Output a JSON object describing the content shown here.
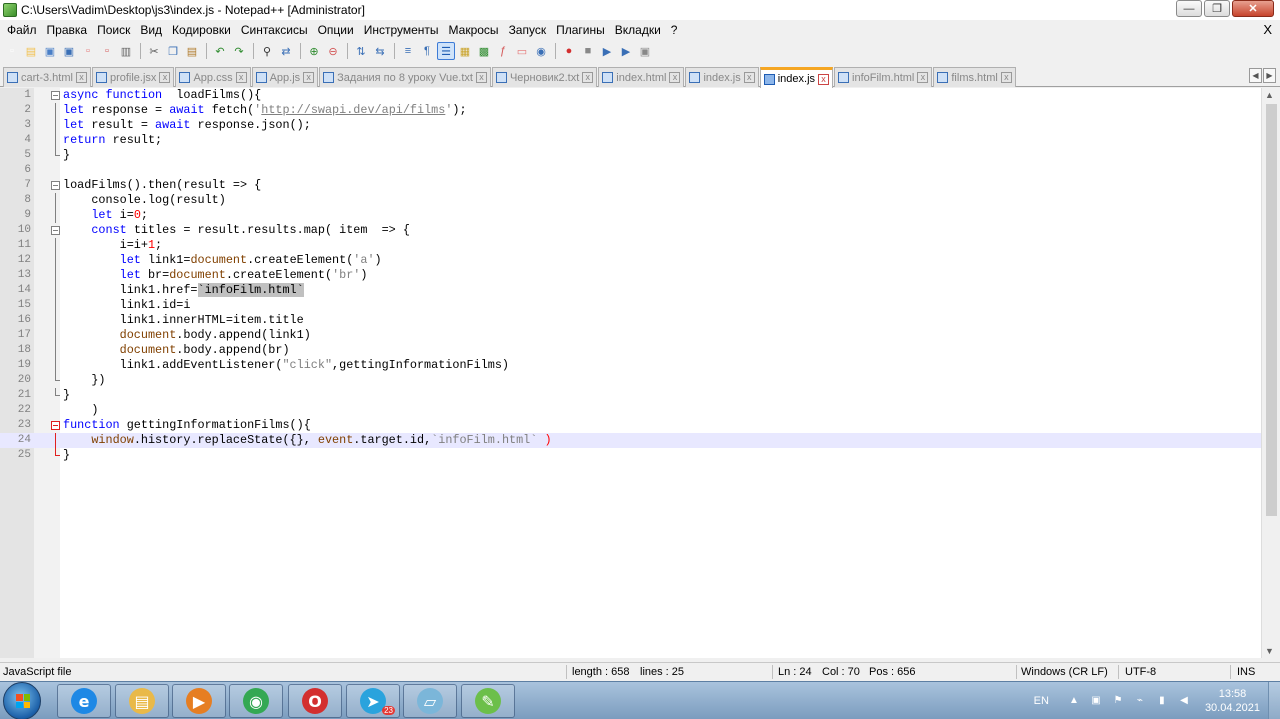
{
  "window": {
    "title": "C:\\Users\\Vadim\\Desktop\\js3\\index.js - Notepad++ [Administrator]",
    "minimize_glyph": "—",
    "restore_glyph": "❐",
    "close_glyph": "✕"
  },
  "menu": {
    "items": [
      "Файл",
      "Правка",
      "Поиск",
      "Вид",
      "Кодировки",
      "Синтаксисы",
      "Опции",
      "Инструменты",
      "Макросы",
      "Запуск",
      "Плагины",
      "Вкладки",
      "?"
    ],
    "close_glyph": "X"
  },
  "toolbar": {
    "buttons": [
      {
        "name": "new-file-icon",
        "glyph": "▫",
        "color": "#ffffff"
      },
      {
        "name": "open-file-icon",
        "glyph": "▤",
        "color": "#f2c14e"
      },
      {
        "name": "save-icon",
        "glyph": "▣",
        "color": "#4a7fc7"
      },
      {
        "name": "save-all-icon",
        "glyph": "▣",
        "color": "#3a6fb6"
      },
      {
        "name": "close-file-icon",
        "glyph": "▫",
        "color": "#e57373"
      },
      {
        "name": "close-all-icon",
        "glyph": "▫",
        "color": "#d35454"
      },
      {
        "name": "print-icon",
        "glyph": "▥",
        "color": "#666666"
      },
      {
        "sep": true
      },
      {
        "name": "cut-icon",
        "glyph": "✂",
        "color": "#555555"
      },
      {
        "name": "copy-icon",
        "glyph": "❐",
        "color": "#3a6fb6"
      },
      {
        "name": "paste-icon",
        "glyph": "▤",
        "color": "#b07b2c"
      },
      {
        "sep": true
      },
      {
        "name": "undo-icon",
        "glyph": "↶",
        "color": "#2e8b2e"
      },
      {
        "name": "redo-icon",
        "glyph": "↷",
        "color": "#2e8b2e"
      },
      {
        "sep": true
      },
      {
        "name": "find-icon",
        "glyph": "⚲",
        "color": "#333333"
      },
      {
        "name": "replace-icon",
        "glyph": "⇄",
        "color": "#3a6fb6"
      },
      {
        "sep": true
      },
      {
        "name": "zoom-in-icon",
        "glyph": "⊕",
        "color": "#2e8b2e"
      },
      {
        "name": "zoom-out-icon",
        "glyph": "⊖",
        "color": "#d35454"
      },
      {
        "sep": true
      },
      {
        "name": "sync-vertical-icon",
        "glyph": "⇅",
        "color": "#3a6fb6"
      },
      {
        "name": "sync-horizontal-icon",
        "glyph": "⇆",
        "color": "#3a6fb6"
      },
      {
        "sep": true
      },
      {
        "name": "word-wrap-icon",
        "glyph": "≡",
        "color": "#3a6fb6"
      },
      {
        "name": "show-all-chars-icon",
        "glyph": "¶",
        "color": "#3a6fb6"
      },
      {
        "name": "indent-guide-icon",
        "glyph": "☰",
        "color": "#1e5cb3",
        "active": true
      },
      {
        "name": "udl-icon",
        "glyph": "▦",
        "color": "#c9a227"
      },
      {
        "name": "doc-map-icon",
        "glyph": "▩",
        "color": "#2e8b2e"
      },
      {
        "name": "function-list-icon",
        "glyph": "ƒ",
        "color": "#d35454"
      },
      {
        "name": "folder-workspace-icon",
        "glyph": "▭",
        "color": "#e57373"
      },
      {
        "name": "monitoring-icon",
        "glyph": "◉",
        "color": "#3a6fb6"
      },
      {
        "sep": true
      },
      {
        "name": "record-macro-icon",
        "glyph": "●",
        "color": "#d32f2f"
      },
      {
        "name": "stop-macro-icon",
        "glyph": "■",
        "color": "#888888"
      },
      {
        "name": "play-macro-icon",
        "glyph": "▶",
        "color": "#3a6fb6"
      },
      {
        "name": "play-multiple-icon",
        "glyph": "▶",
        "color": "#3a6fb6"
      },
      {
        "name": "save-macro-icon",
        "glyph": "▣",
        "color": "#888888"
      }
    ]
  },
  "tabs": [
    {
      "label": "cart-3.html",
      "active": false
    },
    {
      "label": "profile.jsx",
      "active": false
    },
    {
      "label": "App.css",
      "active": false
    },
    {
      "label": "App.js",
      "active": false
    },
    {
      "label": "Задания по 8 уроку Vue.txt",
      "active": false
    },
    {
      "label": "Черновик2.txt",
      "active": false
    },
    {
      "label": "index.html",
      "active": false
    },
    {
      "label": "index.js",
      "active": false
    },
    {
      "label": "index.js",
      "active": true
    },
    {
      "label": "infoFilm.html",
      "active": false
    },
    {
      "label": "films.html",
      "active": false
    }
  ],
  "tab_close_glyph": "x",
  "tab_scroll": [
    "◀",
    "▶"
  ],
  "editor": {
    "current_line": 24,
    "lines": [
      {
        "n": "1",
        "fold": "box",
        "red": false,
        "tokens": [
          [
            "kw",
            "async function"
          ],
          [
            "",
            "  loadFilms(){"
          ]
        ]
      },
      {
        "n": "2",
        "fold": "bar",
        "red": false,
        "tokens": [
          [
            "kw",
            "let"
          ],
          [
            "",
            " response = "
          ],
          [
            "kw",
            "await"
          ],
          [
            "",
            " fetch("
          ],
          [
            "str",
            "'"
          ],
          [
            "url",
            "http://swapi.dev/api/films"
          ],
          [
            "str",
            "'"
          ],
          [
            "",
            ");"
          ]
        ]
      },
      {
        "n": "3",
        "fold": "bar",
        "red": false,
        "tokens": [
          [
            "kw",
            "let"
          ],
          [
            "",
            " result = "
          ],
          [
            "kw",
            "await"
          ],
          [
            "",
            " response.json();"
          ]
        ]
      },
      {
        "n": "4",
        "fold": "bar",
        "red": false,
        "tokens": [
          [
            "kw",
            "return"
          ],
          [
            "",
            " result;"
          ]
        ]
      },
      {
        "n": "5",
        "fold": "end",
        "red": false,
        "tokens": [
          [
            "",
            "}"
          ]
        ]
      },
      {
        "n": "6",
        "fold": "",
        "red": false,
        "tokens": [
          [
            "",
            ""
          ]
        ]
      },
      {
        "n": "7",
        "fold": "box",
        "red": false,
        "tokens": [
          [
            "",
            "loadFilms().then(result => {"
          ]
        ]
      },
      {
        "n": "8",
        "fold": "bar",
        "red": false,
        "tokens": [
          [
            "",
            "    console.log(result)"
          ]
        ]
      },
      {
        "n": "9",
        "fold": "bar",
        "red": false,
        "tokens": [
          [
            "",
            "    "
          ],
          [
            "kw",
            "let"
          ],
          [
            "",
            " i="
          ],
          [
            "num",
            "0"
          ],
          [
            "",
            ";"
          ]
        ]
      },
      {
        "n": "10",
        "fold": "box",
        "red": false,
        "tokens": [
          [
            "",
            "    "
          ],
          [
            "kw",
            "const"
          ],
          [
            "",
            " titles = result.results.map( item  => {"
          ]
        ]
      },
      {
        "n": "11",
        "fold": "bar",
        "red": false,
        "tokens": [
          [
            "",
            "        i=i+"
          ],
          [
            "num",
            "1"
          ],
          [
            "",
            ";"
          ]
        ]
      },
      {
        "n": "12",
        "fold": "bar",
        "red": false,
        "tokens": [
          [
            "",
            "        "
          ],
          [
            "kw",
            "let"
          ],
          [
            "",
            " link1="
          ],
          [
            "obj",
            "document"
          ],
          [
            "",
            ".createElement("
          ],
          [
            "str",
            "'a'"
          ],
          [
            "",
            ")"
          ]
        ]
      },
      {
        "n": "13",
        "fold": "bar",
        "red": false,
        "tokens": [
          [
            "",
            "        "
          ],
          [
            "kw",
            "let"
          ],
          [
            "",
            " br="
          ],
          [
            "obj",
            "document"
          ],
          [
            "",
            ".createElement("
          ],
          [
            "str",
            "'br'"
          ],
          [
            "",
            ")"
          ]
        ]
      },
      {
        "n": "14",
        "fold": "bar",
        "red": false,
        "tokens": [
          [
            "",
            "        link1.href="
          ],
          [
            "sel",
            "`infoFilm.html`"
          ]
        ]
      },
      {
        "n": "15",
        "fold": "bar",
        "red": false,
        "tokens": [
          [
            "",
            "        link1.id=i"
          ]
        ]
      },
      {
        "n": "16",
        "fold": "bar",
        "red": false,
        "tokens": [
          [
            "",
            "        link1.innerHTML=item.title"
          ]
        ]
      },
      {
        "n": "17",
        "fold": "bar",
        "red": false,
        "tokens": [
          [
            "",
            "        "
          ],
          [
            "obj",
            "document"
          ],
          [
            "",
            ".body.append(link1)"
          ]
        ]
      },
      {
        "n": "18",
        "fold": "bar",
        "red": false,
        "tokens": [
          [
            "",
            "        "
          ],
          [
            "obj",
            "document"
          ],
          [
            "",
            ".body.append(br)"
          ]
        ]
      },
      {
        "n": "19",
        "fold": "bar",
        "red": false,
        "tokens": [
          [
            "",
            "        link1.addEventListener("
          ],
          [
            "str",
            "\"click\""
          ],
          [
            "",
            ",gettingInformationFilms)"
          ]
        ]
      },
      {
        "n": "20",
        "fold": "end",
        "red": false,
        "tokens": [
          [
            "",
            "    })"
          ]
        ]
      },
      {
        "n": "21",
        "fold": "end",
        "red": false,
        "tokens": [
          [
            "",
            "}"
          ]
        ]
      },
      {
        "n": "22",
        "fold": "",
        "red": false,
        "tokens": [
          [
            "",
            "    )"
          ]
        ]
      },
      {
        "n": "23",
        "fold": "box",
        "red": true,
        "tokens": [
          [
            "kw",
            "function"
          ],
          [
            "",
            " gettingInformationFilms(){"
          ]
        ]
      },
      {
        "n": "24",
        "fold": "bar",
        "red": true,
        "tokens": [
          [
            "",
            "    "
          ],
          [
            "obj",
            "window"
          ],
          [
            "",
            ".history.replaceState({}, "
          ],
          [
            "obj",
            "event"
          ],
          [
            "",
            ".target.id,"
          ],
          [
            "str",
            "`infoFilm.html`"
          ],
          [
            "",
            " "
          ],
          [
            "brace-hl",
            ")"
          ]
        ]
      },
      {
        "n": "25",
        "fold": "end",
        "red": true,
        "tokens": [
          [
            "",
            "}"
          ]
        ]
      }
    ]
  },
  "statusbar": {
    "filetype": "JavaScript file",
    "length": "length : 658",
    "lines": "lines : 25",
    "ln": "Ln : 24",
    "col": "Col : 70",
    "pos": "Pos : 656",
    "eol": "Windows (CR LF)",
    "encoding": "UTF-8",
    "mode": "INS"
  },
  "taskbar": {
    "apps": [
      {
        "name": "internet-explorer-icon",
        "glyph": "e",
        "bg": "#1e88e5"
      },
      {
        "name": "file-explorer-icon",
        "glyph": "▤",
        "bg": "#e9b949"
      },
      {
        "name": "media-player-icon",
        "glyph": "▶",
        "bg": "#e67e22"
      },
      {
        "name": "chrome-icon",
        "glyph": "◉",
        "bg": "#34a853"
      },
      {
        "name": "opera-icon",
        "glyph": "O",
        "bg": "#d32f2f"
      },
      {
        "name": "telegram-icon",
        "glyph": "➤",
        "bg": "#2aa3dd",
        "badge": "23"
      },
      {
        "name": "notepad-icon",
        "glyph": "▱",
        "bg": "#7bb6d9"
      },
      {
        "name": "notepadpp-icon",
        "glyph": "✎",
        "bg": "#6cbf4a"
      }
    ],
    "tray": {
      "lang": "EN",
      "time": "13:58",
      "date": "30.04.2021"
    }
  }
}
